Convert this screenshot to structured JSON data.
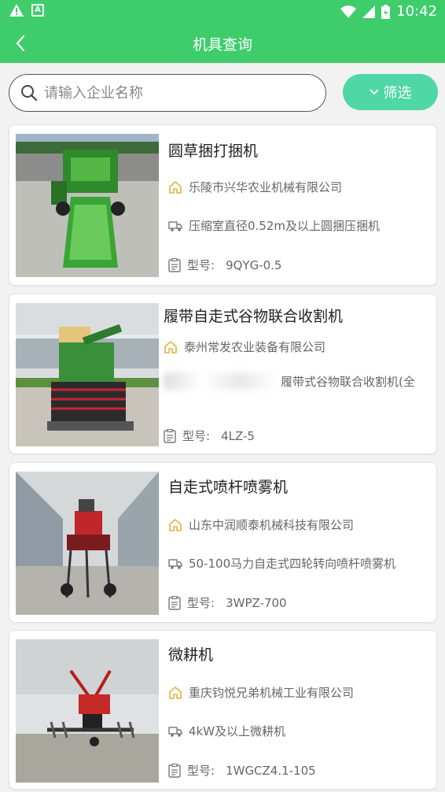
{
  "status": {
    "time": "10:42"
  },
  "appbar": {
    "title": "机具查询"
  },
  "search": {
    "placeholder": "请输入企业名称",
    "filter_label": "筛选"
  },
  "items": [
    {
      "name": "圆草捆打捆机",
      "company": "乐陵市兴华农业机械有限公司",
      "desc": "压缩室直径0.52m及以上圆捆压捆机",
      "model_label": "型号:",
      "model": "9QYG-0.5"
    },
    {
      "name": "履带自走式谷物联合收割机",
      "company": "泰州常发农业装备有限公司",
      "desc": "履带式谷物联合收割机(全",
      "model_label": "型号:",
      "model": "4LZ-5"
    },
    {
      "name": "自走式喷杆喷雾机",
      "company": "山东中润顺泰机械科技有限公司",
      "desc": "50-100马力自走式四轮转向喷杆喷雾机",
      "model_label": "型号:",
      "model": "3WPZ-700"
    },
    {
      "name": "微耕机",
      "company": "重庆钧悦兄弟机械工业有限公司",
      "desc": "4kW及以上微耕机",
      "model_label": "型号:",
      "model": "1WGCZ4.1-105"
    }
  ]
}
